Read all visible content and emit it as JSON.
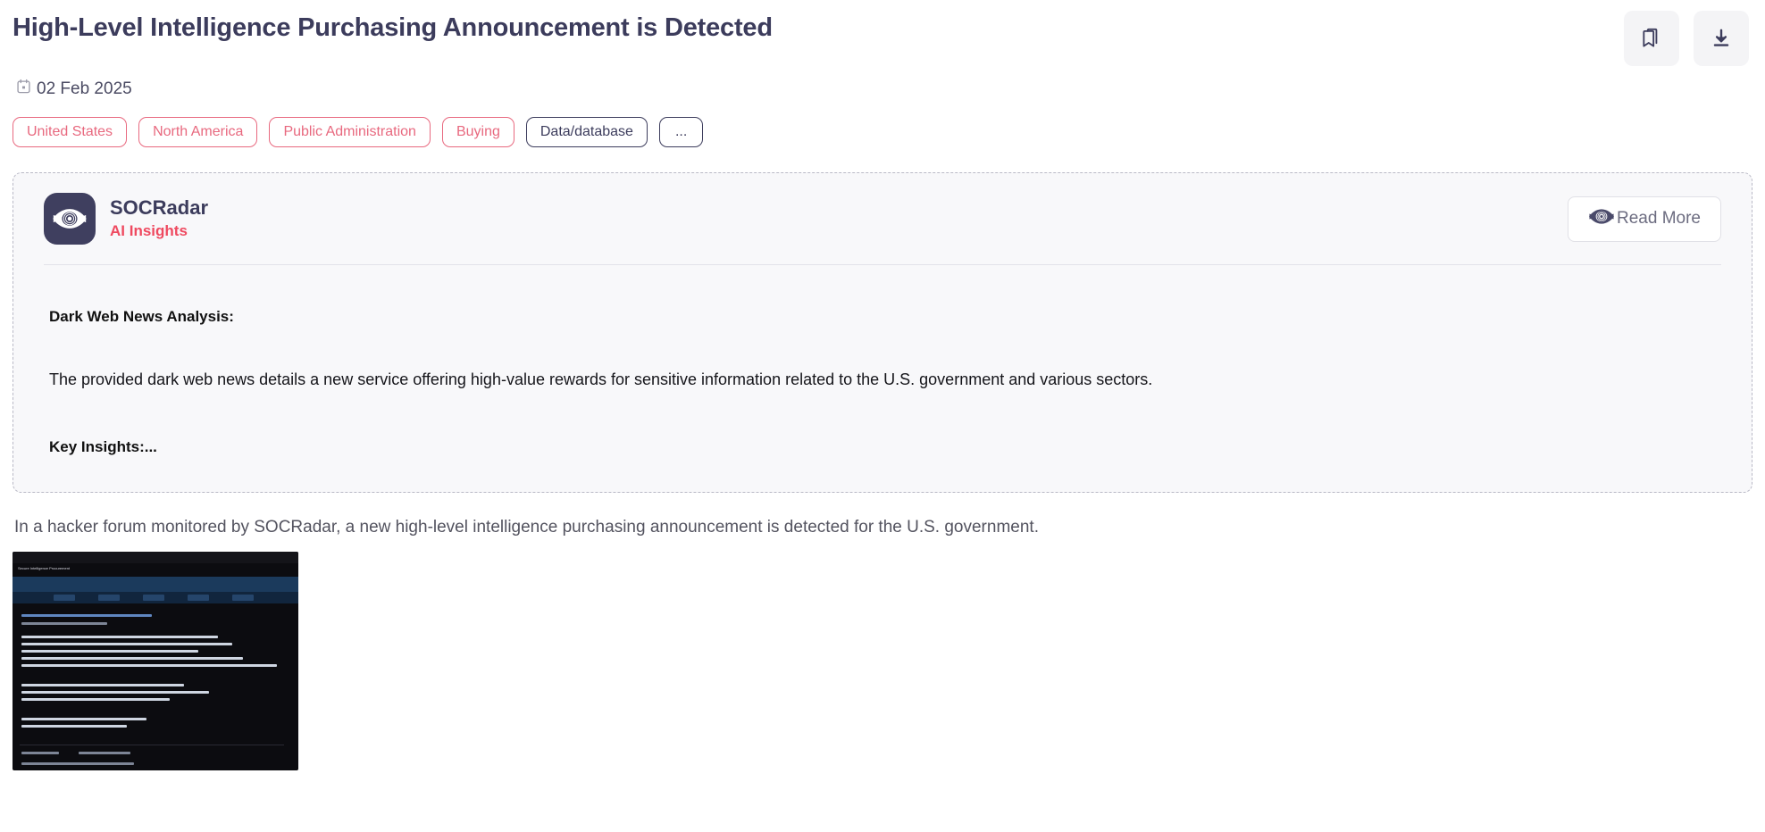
{
  "header": {
    "title": "High-Level Intelligence Purchasing Announcement is Detected",
    "date": "02 Feb 2025",
    "calendar_icon": "calendar-icon",
    "actions": [
      {
        "name": "bookmark-button",
        "icon": "bookmark-icon",
        "label": ""
      },
      {
        "name": "download-button",
        "icon": "download-icon",
        "label": ""
      }
    ]
  },
  "tags": [
    {
      "label": "United States",
      "style": "rose"
    },
    {
      "label": "North America",
      "style": "rose"
    },
    {
      "label": "Public Administration",
      "style": "rose"
    },
    {
      "label": "Buying",
      "style": "rose"
    },
    {
      "label": "Data/database",
      "style": "navy"
    },
    {
      "label": "...",
      "style": "more"
    }
  ],
  "insights": {
    "brand_name": "SOCRadar",
    "brand_sub": "AI Insights",
    "brand_logo_icon": "socradar-eye-logo-icon",
    "read_more_label": "Read More",
    "read_more_icon": "socradar-eye-icon",
    "heading": "Dark Web News Analysis:",
    "paragraph": "The provided dark web news details a new service offering high-value rewards for sensitive information related to the U.S. government and various sectors.",
    "key_insights_label": "Key Insights:..."
  },
  "article": {
    "lead": "In a hacker forum monitored by SOCRadar, a new high-level intelligence purchasing announcement is detected for the U.S. government.",
    "thumbnail": {
      "name": "forum-post-screenshot",
      "window_title": "Secure Intelligence Procurement",
      "alt": "Dark web hacker forum post screenshot"
    }
  },
  "colors": {
    "navy": "#3c3c5c",
    "rose": "#e8697f",
    "accent_red": "#ef4a60",
    "card_bg": "#f8f8fa",
    "icon_btn_bg": "#f4f4f6"
  }
}
